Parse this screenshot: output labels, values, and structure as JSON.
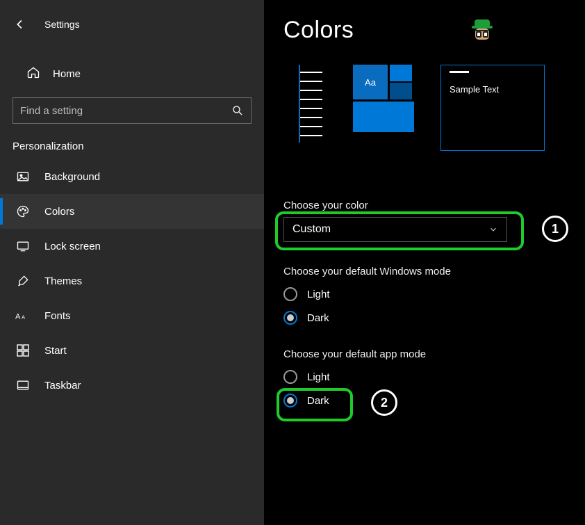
{
  "app_title": "Settings",
  "home_label": "Home",
  "search": {
    "placeholder": "Find a setting"
  },
  "section": "Personalization",
  "nav": [
    {
      "label": "Background",
      "icon": "image-icon"
    },
    {
      "label": "Colors",
      "icon": "palette-icon"
    },
    {
      "label": "Lock screen",
      "icon": "lockscreen-icon"
    },
    {
      "label": "Themes",
      "icon": "brush-icon"
    },
    {
      "label": "Fonts",
      "icon": "font-icon"
    },
    {
      "label": "Start",
      "icon": "start-icon"
    },
    {
      "label": "Taskbar",
      "icon": "taskbar-icon"
    }
  ],
  "nav_selected_index": 1,
  "page_title": "Colors",
  "preview": {
    "sample_text": "Sample Text",
    "tile_text": "Aa"
  },
  "choose_color": {
    "label": "Choose your color",
    "value": "Custom"
  },
  "windows_mode": {
    "label": "Choose your default Windows mode",
    "options": [
      "Light",
      "Dark"
    ],
    "selected": "Dark"
  },
  "app_mode": {
    "label": "Choose your default app mode",
    "options": [
      "Light",
      "Dark"
    ],
    "selected": "Dark"
  },
  "annotations": {
    "n1": "1",
    "n2": "2"
  },
  "colors": {
    "accent": "#0078d7",
    "highlight": "#1ecb2a"
  }
}
